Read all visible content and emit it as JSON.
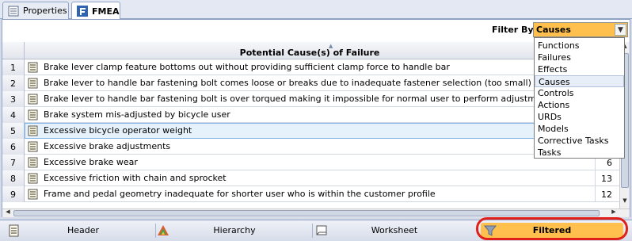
{
  "tabs": [
    {
      "label": "Properties",
      "icon": "properties-icon"
    },
    {
      "label": "FMEA",
      "icon": "fmea-icon"
    }
  ],
  "filter": {
    "label": "Filter By",
    "value": "Causes",
    "options": [
      "Functions",
      "Failures",
      "Effects",
      "Causes",
      "Controls",
      "Actions",
      "URDs",
      "Models",
      "Corrective Tasks",
      "Tasks"
    ],
    "selected_index": 3
  },
  "grid": {
    "column_header": "Potential Cause(s) of Failure",
    "rows": [
      {
        "num": "1",
        "text": "Brake lever clamp feature bottoms out without providing sufficient clamp force to handle bar",
        "value": ""
      },
      {
        "num": "2",
        "text": "Brake lever to handle bar fastening bolt comes loose or breaks due to inadequate fastener selection (too small)",
        "value": ""
      },
      {
        "num": "3",
        "text": "Brake lever to handle bar fastening bolt is over torqued making it impossible for normal user to perform adjustment proced",
        "value": ""
      },
      {
        "num": "4",
        "text": "Brake system mis-adjusted by bicycle user",
        "value": ""
      },
      {
        "num": "5",
        "text": "Excessive bicycle operator weight",
        "value": ""
      },
      {
        "num": "6",
        "text": "Excessive brake adjustments",
        "value": ""
      },
      {
        "num": "7",
        "text": "Excessive brake wear",
        "value": "6"
      },
      {
        "num": "8",
        "text": "Excessive friction with chain and sprocket",
        "value": "13"
      },
      {
        "num": "9",
        "text": "Frame and pedal geometry inadequate for shorter user who is within the customer profile",
        "value": "12"
      }
    ],
    "selected_row": 4
  },
  "bottom_tabs": [
    {
      "label": "Header",
      "icon": "header-icon"
    },
    {
      "label": "Hierarchy",
      "icon": "hierarchy-icon"
    },
    {
      "label": "Worksheet",
      "icon": "worksheet-icon"
    },
    {
      "label": "Filtered",
      "icon": "filter-icon"
    }
  ],
  "colors": {
    "accent_orange": "#ffc04d",
    "highlight_ring": "#e0201b",
    "selection": "#e6f2fb"
  }
}
